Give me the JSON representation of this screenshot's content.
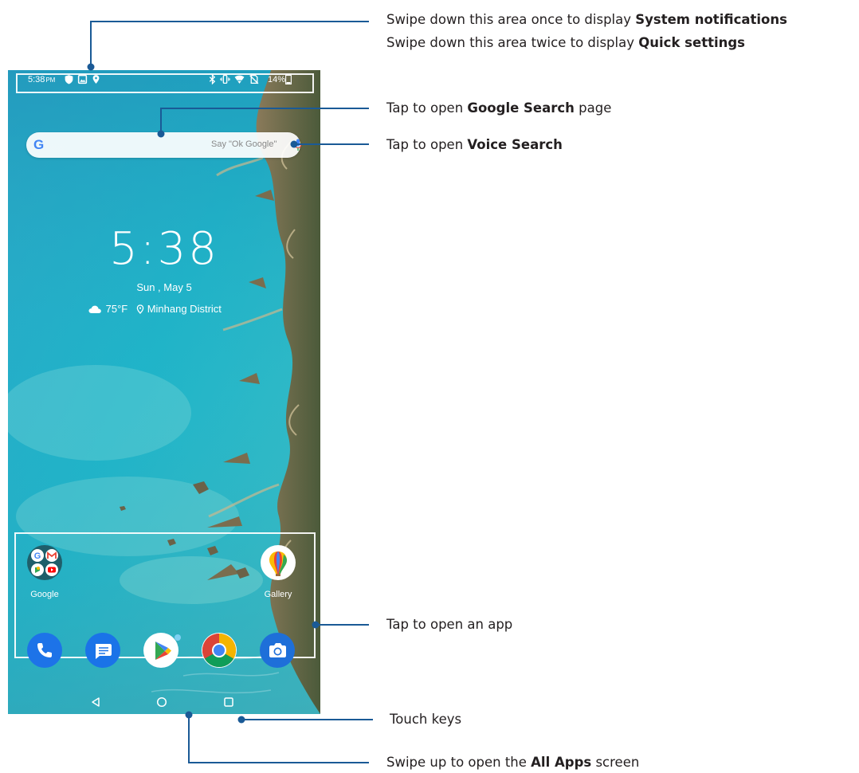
{
  "status_bar": {
    "time": "5:38",
    "ampm": "PM",
    "battery": "14%",
    "left_icons": [
      "shield-icon",
      "image-icon",
      "location-icon"
    ],
    "right_icons": [
      "bluetooth-icon",
      "vibrate-icon",
      "wifi-icon",
      "no-sim-icon",
      "battery-icon"
    ]
  },
  "search_bar": {
    "logo": "G",
    "hint": "Say \"Ok Google\""
  },
  "clock_widget": {
    "time": "5:38",
    "date": "Sun , May 5",
    "temperature": "75°F",
    "location": "Minhang District"
  },
  "home_apps": [
    {
      "name": "Google",
      "icon": "google-folder-icon"
    },
    {
      "name": "Gallery",
      "icon": "gallery-icon"
    }
  ],
  "dock": [
    "phone-icon",
    "messages-icon",
    "play-store-icon",
    "chrome-icon",
    "camera-icon"
  ],
  "touch_keys": [
    "back-icon",
    "home-icon",
    "recents-icon"
  ],
  "callouts": {
    "status": {
      "line1_pre": "Swipe down this area once to display ",
      "line1_bold": "System notifications",
      "line2_pre": "Swipe down this area twice to display ",
      "line2_bold": "Quick settings"
    },
    "google_search": {
      "pre": "Tap to open ",
      "bold": "Google Search",
      "post": " page"
    },
    "voice_search": {
      "pre": "Tap to open ",
      "bold": "Voice Search"
    },
    "open_app": {
      "text": "Tap to open an app"
    },
    "touch_keys": {
      "text": "Touch keys"
    },
    "all_apps": {
      "pre": "Swipe up to open the ",
      "bold": "All Apps",
      "post": " screen"
    }
  },
  "colors": {
    "leader_line": "#1a5a96",
    "phone_blue": "#1d73e8",
    "messages_blue": "#1a73e8",
    "camera_blue": "#1e6fd9"
  }
}
